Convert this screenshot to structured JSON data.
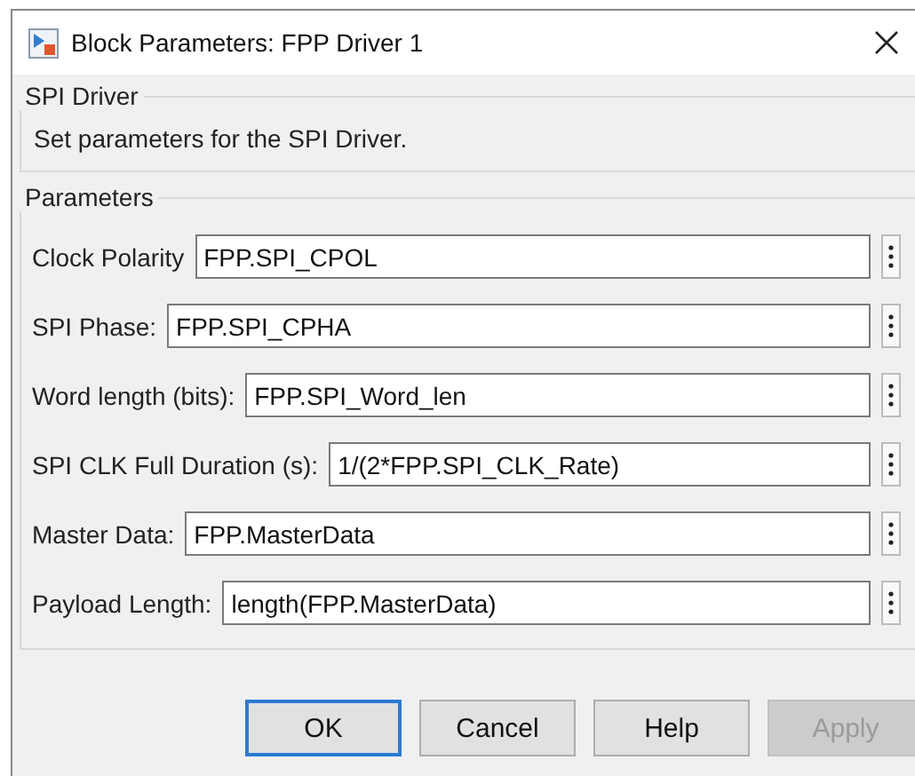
{
  "window": {
    "title": "Block Parameters: FPP Driver 1"
  },
  "description_group": {
    "title": "SPI Driver",
    "text": "Set parameters for the SPI Driver."
  },
  "parameters_group": {
    "title": "Parameters",
    "fields": [
      {
        "label": "Clock Polarity",
        "value": "FPP.SPI_CPOL"
      },
      {
        "label": "SPI Phase:",
        "value": "FPP.SPI_CPHA"
      },
      {
        "label": "Word length (bits):",
        "value": "FPP.SPI_Word_len"
      },
      {
        "label": "SPI CLK Full Duration (s):",
        "value": "1/(2*FPP.SPI_CLK_Rate)"
      },
      {
        "label": "Master Data:",
        "value": "FPP.MasterData"
      },
      {
        "label": "Payload Length:",
        "value": "length(FPP.MasterData)"
      }
    ]
  },
  "buttons": [
    {
      "label": "OK",
      "default": true,
      "disabled": false
    },
    {
      "label": "Cancel",
      "default": false,
      "disabled": false
    },
    {
      "label": "Help",
      "default": false,
      "disabled": false
    },
    {
      "label": "Apply",
      "default": false,
      "disabled": true
    }
  ]
}
